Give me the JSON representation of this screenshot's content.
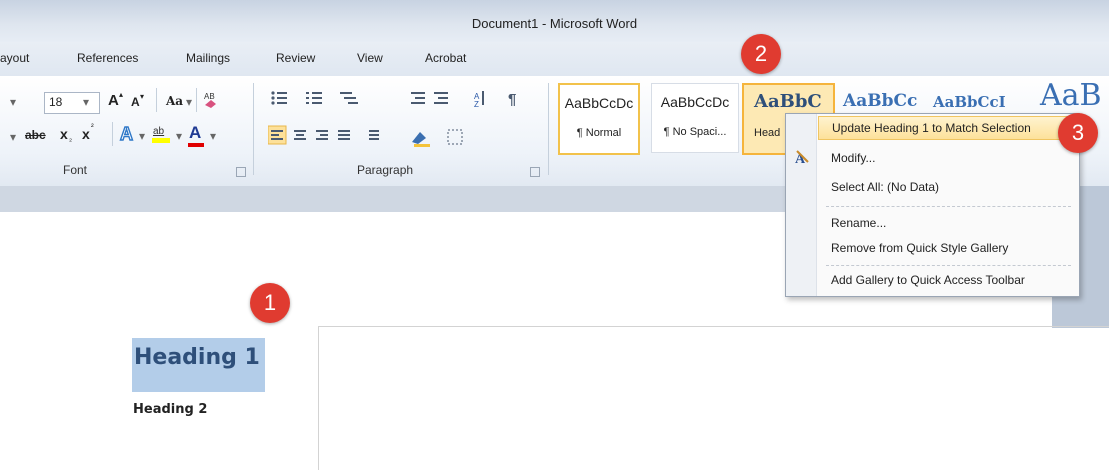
{
  "window": {
    "title": "Document1  -  Microsoft Word"
  },
  "tabs": [
    "ayout",
    "References",
    "Mailings",
    "Review",
    "View",
    "Acrobat"
  ],
  "font_group": {
    "label": "Font",
    "font_size": "18",
    "grow_font": "A",
    "shrink_font": "A",
    "change_case": "Aa",
    "strikethrough": "abc",
    "subscript": "x",
    "superscript": "x",
    "font_color": "A"
  },
  "paragraph_group": {
    "label": "Paragraph"
  },
  "styles": [
    {
      "preview": "AaBbCcDc",
      "name": "¶ Normal"
    },
    {
      "preview": "AaBbCcDc",
      "name": "¶ No Spaci..."
    },
    {
      "preview": "AaBbC",
      "name": "Head"
    },
    {
      "preview": "AaBbCc",
      "name": ""
    },
    {
      "preview": "AaBbCcI",
      "name": ""
    },
    {
      "preview": "AaB",
      "name": ""
    }
  ],
  "context_menu": {
    "items": [
      "Update Heading 1 to Match Selection",
      "Modify...",
      "Select All: (No Data)",
      "Rename...",
      "Remove from Quick Style Gallery",
      "Add Gallery to Quick Access Toolbar"
    ]
  },
  "document": {
    "heading1": "Heading 1",
    "heading2": "Heading 2"
  },
  "badges": [
    "1",
    "2",
    "3"
  ],
  "colors": {
    "accent_badge": "#e03b30",
    "selection": "#b3cde9",
    "hover": "#fde19a"
  }
}
